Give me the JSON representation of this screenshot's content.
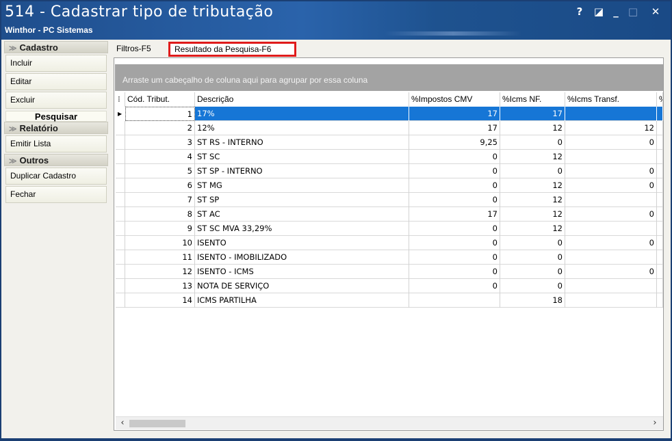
{
  "window": {
    "title": "514 - Cadastrar tipo de tributação",
    "subtitle": "Winthor - PC Sistemas",
    "buttons": {
      "help": "?",
      "restore": "◪",
      "minimize": "_",
      "maximize": "□",
      "close": "✕"
    }
  },
  "sidebar": {
    "groups": [
      {
        "title": "Cadastro",
        "items": [
          "Incluir",
          "Editar",
          "Excluir"
        ],
        "active": "Pesquisar"
      },
      {
        "title": "Relatório",
        "items": [
          "Emitir Lista"
        ]
      },
      {
        "title": "Outros",
        "items": [
          "Duplicar Cadastro",
          "Fechar"
        ]
      }
    ]
  },
  "tabs": [
    "Filtros-F5",
    "Resultado da Pesquisa-F6"
  ],
  "active_tab": "Resultado da Pesquisa-F6",
  "grid": {
    "group_hint": "Arraste um cabeçalho de coluna aqui para agrupar por essa coluna",
    "columns": [
      "Cód. Tribut.",
      "Descrição",
      "%Impostos CMV",
      "%Icms NF.",
      "%Icms Transf.",
      "%"
    ],
    "rows": [
      {
        "cod": "1",
        "desc": "17%",
        "cmv": "17",
        "nf": "17",
        "transf": ""
      },
      {
        "cod": "2",
        "desc": "12%",
        "cmv": "17",
        "nf": "12",
        "transf": "12"
      },
      {
        "cod": "3",
        "desc": "ST RS - INTERNO",
        "cmv": "9,25",
        "nf": "0",
        "transf": "0"
      },
      {
        "cod": "4",
        "desc": "ST SC",
        "cmv": "0",
        "nf": "12",
        "transf": ""
      },
      {
        "cod": "5",
        "desc": "ST SP - INTERNO",
        "cmv": "0",
        "nf": "0",
        "transf": "0"
      },
      {
        "cod": "6",
        "desc": "ST MG",
        "cmv": "0",
        "nf": "12",
        "transf": "0"
      },
      {
        "cod": "7",
        "desc": "ST SP",
        "cmv": "0",
        "nf": "12",
        "transf": ""
      },
      {
        "cod": "8",
        "desc": "ST AC",
        "cmv": "17",
        "nf": "12",
        "transf": "0"
      },
      {
        "cod": "9",
        "desc": "ST SC MVA 33,29%",
        "cmv": "0",
        "nf": "12",
        "transf": ""
      },
      {
        "cod": "10",
        "desc": "ISENTO",
        "cmv": "0",
        "nf": "0",
        "transf": "0"
      },
      {
        "cod": "11",
        "desc": "ISENTO - IMOBILIZADO",
        "cmv": "0",
        "nf": "0",
        "transf": ""
      },
      {
        "cod": "12",
        "desc": "ISENTO - ICMS",
        "cmv": "0",
        "nf": "0",
        "transf": "0"
      },
      {
        "cod": "13",
        "desc": "NOTA DE SERVIÇO",
        "cmv": "0",
        "nf": "0",
        "transf": ""
      },
      {
        "cod": "14",
        "desc": "ICMS PARTILHA",
        "cmv": "",
        "nf": "18",
        "transf": ""
      }
    ],
    "selected_row": "1",
    "row_indicator_icon": "row-pointer-icon"
  },
  "colors": {
    "selection": "#1676d6",
    "tab_highlight": "#e01b1b",
    "titlebar": "#2a63ab"
  }
}
